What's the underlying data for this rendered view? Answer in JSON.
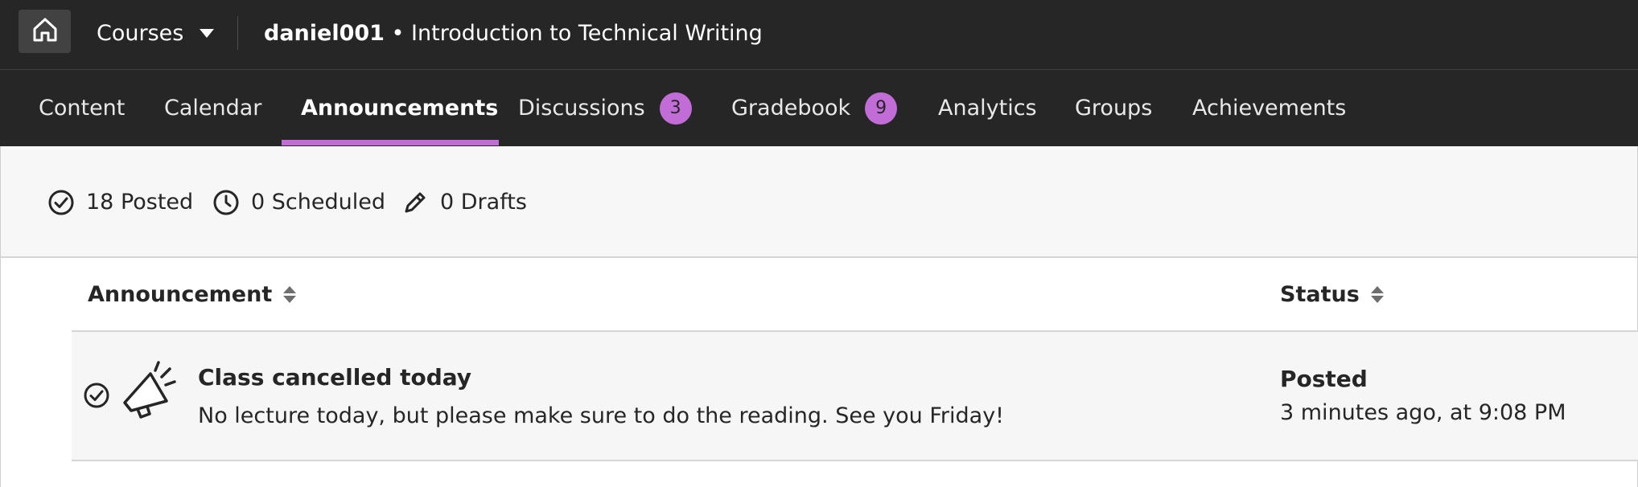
{
  "topbar": {
    "home_icon": "home-icon",
    "courses_label": "Courses",
    "course_user": "daniel001",
    "course_separator": " • ",
    "course_name": "Introduction to Technical Writing"
  },
  "nav": {
    "accent_color": "#c26cd8",
    "tabs": [
      {
        "label": "Content"
      },
      {
        "label": "Calendar"
      },
      {
        "label": "Announcements",
        "active": true
      },
      {
        "label": "Discussions",
        "badge": "3"
      },
      {
        "label": "Gradebook",
        "badge": "9"
      },
      {
        "label": "Analytics"
      },
      {
        "label": "Groups"
      },
      {
        "label": "Achievements"
      }
    ]
  },
  "summary": {
    "posted": "18 Posted",
    "scheduled": "0 Scheduled",
    "drafts": "0 Drafts",
    "icons": [
      "check-circle-icon",
      "clock-icon",
      "pencil-icon"
    ]
  },
  "table": {
    "columns": {
      "announcement": "Announcement",
      "status": "Status"
    },
    "rows": [
      {
        "title": "Class cancelled today",
        "body": "No lecture today, but please make sure to do the reading. See you Friday!",
        "status": "Posted",
        "time": "3 minutes ago, at 9:08 PM",
        "icons": [
          "check-circle-icon",
          "megaphone-icon"
        ]
      }
    ]
  }
}
